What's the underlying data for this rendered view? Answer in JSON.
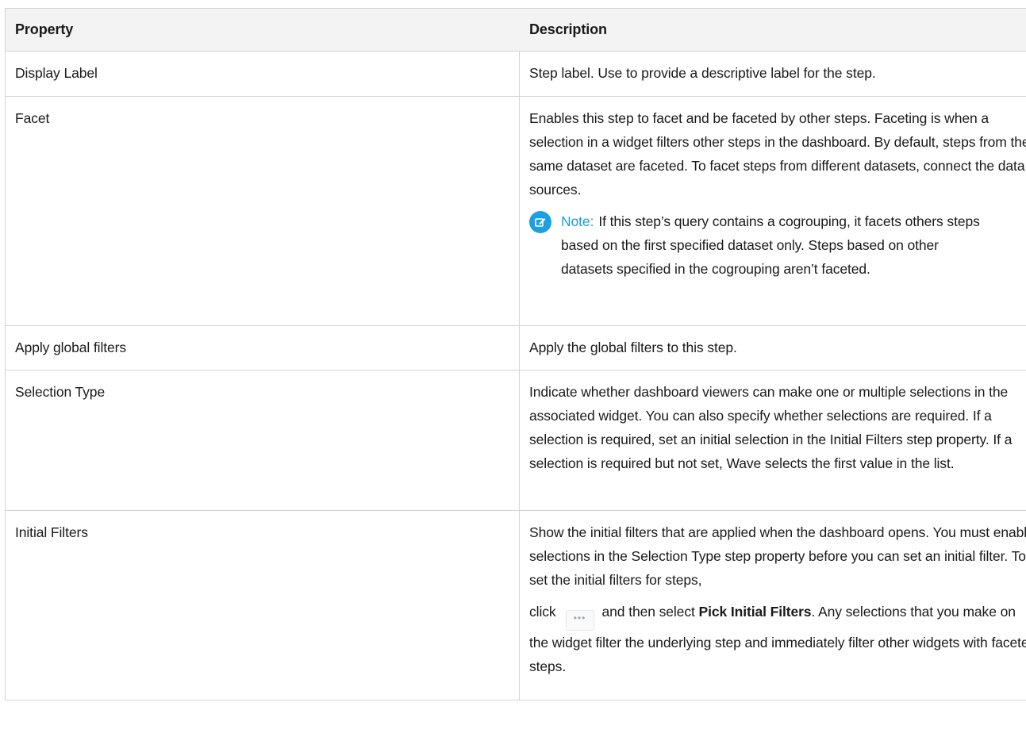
{
  "headers": {
    "property": "Property",
    "description": "Description"
  },
  "rows": [
    {
      "property": "Display Label",
      "description": "Step label. Use to provide a descriptive label for the step."
    },
    {
      "property": "Facet",
      "description": "Enables this step to facet and be faceted by other steps. Faceting is when a selection in a widget filters other steps in the dashboard. By default, steps from the same dataset are faceted. To facet steps from different datasets, connect the data sources.",
      "note_label": "Note:",
      "note_text": "If this step’s query contains a cogrouping, it facets others steps based on the first specified dataset only. Steps based on other datasets specified in the cogrouping aren’t faceted.",
      "note_icon": "edit-note-icon"
    },
    {
      "property": "Apply global filters",
      "description": "Apply the global filters to this step."
    },
    {
      "property": "Selection Type",
      "description": "Indicate whether dashboard viewers can make one or multiple selections in the associated widget. You can also specify whether selections are required. If a selection is required, set an initial selection in the Initial Filters step property. If a selection is required but not set, Wave selects the first value in the list."
    },
    {
      "property": "Initial Filters",
      "description": "Show the initial filters that are applied when the dashboard opens. You must enable selections in the Selection Type step property before you can set an initial filter. To set the initial filters for steps,",
      "click_prefix": "click",
      "click_middle": "and then select",
      "click_bold": "Pick Initial Filters",
      "click_suffix": ". Any selections that you make on the widget filter the underlying step and immediately filter other widgets with faceted steps.",
      "more_icon": "more-actions-icon"
    }
  ],
  "colors": {
    "note_accent": "#1b9ed6",
    "header_bg": "#f3f3f3",
    "border": "#d4d4d4"
  }
}
